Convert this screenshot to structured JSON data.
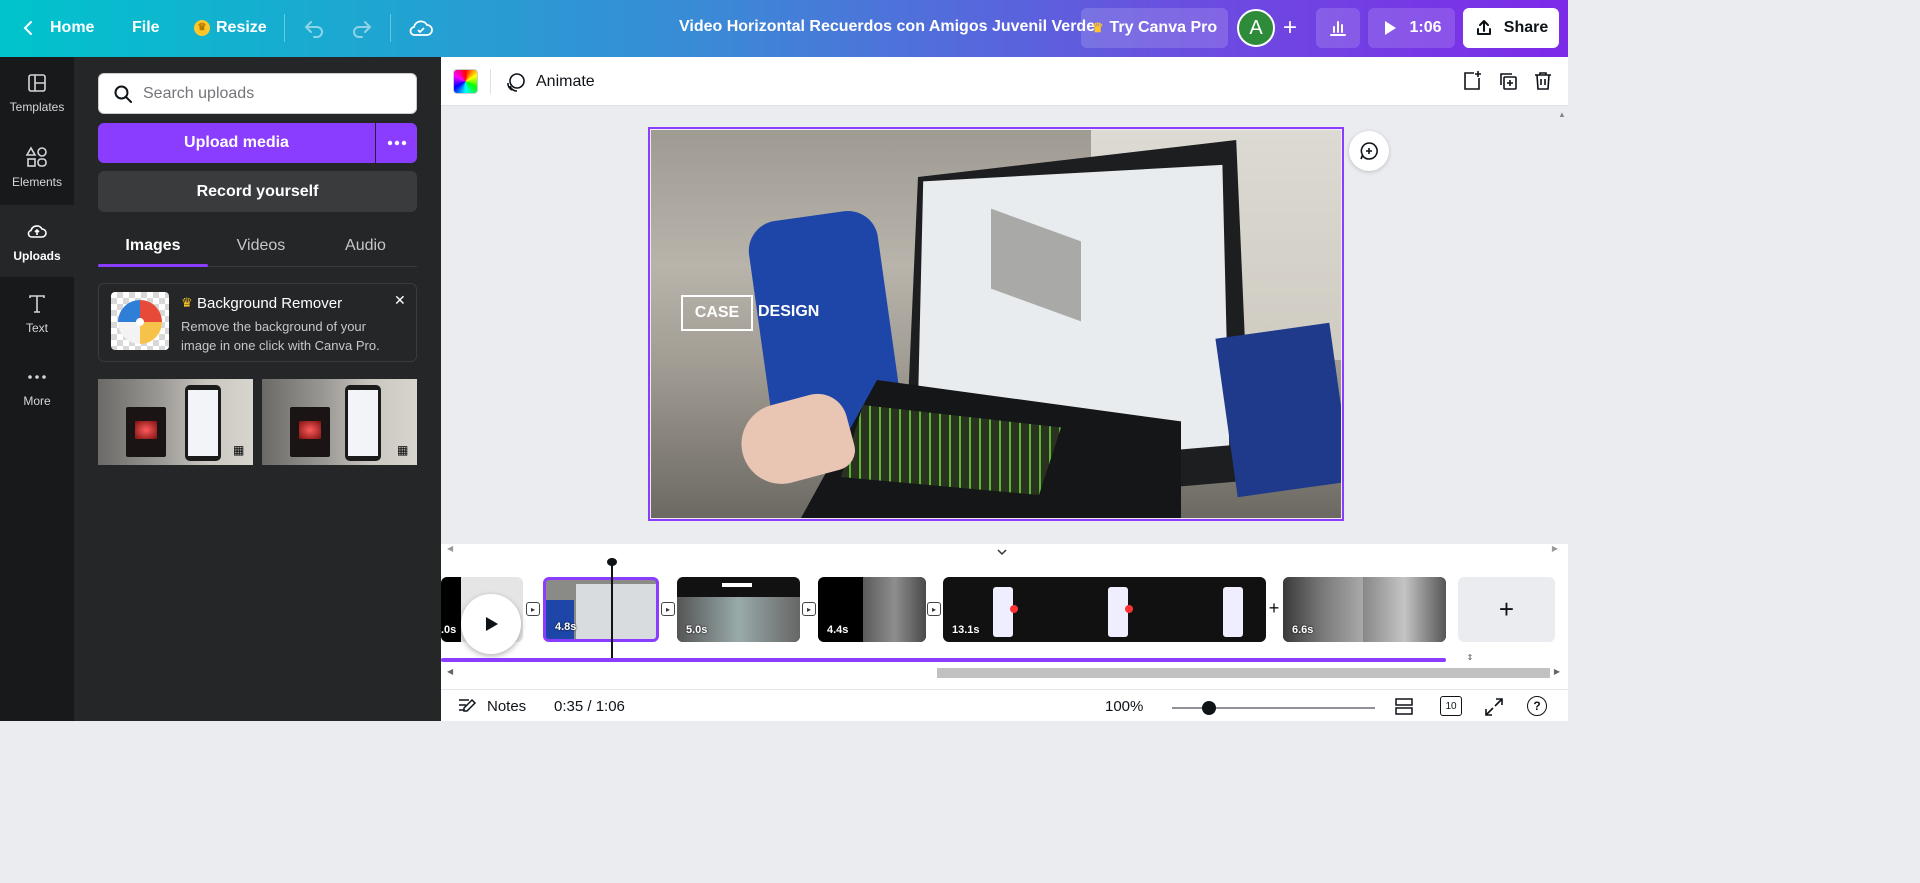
{
  "topbar": {
    "home_label": "Home",
    "file_label": "File",
    "resize_label": "Resize",
    "title": "Video Horizontal Recuerdos con Amigos Juvenil Verde",
    "try_pro_label": "Try Canva Pro",
    "avatar_letter": "A",
    "play_time": "1:06",
    "share_label": "Share"
  },
  "rail": {
    "items": [
      {
        "label": "Templates",
        "icon": "templates-icon"
      },
      {
        "label": "Elements",
        "icon": "elements-icon"
      },
      {
        "label": "Uploads",
        "icon": "uploads-icon",
        "active": true
      },
      {
        "label": "Text",
        "icon": "text-icon"
      },
      {
        "label": "More",
        "icon": "more-icon"
      }
    ]
  },
  "panel": {
    "search_placeholder": "Search uploads",
    "upload_label": "Upload media",
    "record_label": "Record yourself",
    "tabs": [
      "Images",
      "Videos",
      "Audio"
    ],
    "active_tab": "Images",
    "bg_remover": {
      "title": "Background Remover",
      "description": "Remove the background of your image in one click with Canva Pro."
    }
  },
  "context_bar": {
    "animate_label": "Animate"
  },
  "canvas": {
    "overlay_word_1": "CASE",
    "overlay_word_2": "DESIGN"
  },
  "timeline": {
    "clips": [
      {
        "duration": ".0s"
      },
      {
        "duration": "4.8s",
        "selected": true
      },
      {
        "duration": "5.0s"
      },
      {
        "duration": "4.4s"
      },
      {
        "duration": "13.1s"
      },
      {
        "duration": "6.6s"
      }
    ]
  },
  "bottombar": {
    "notes_label": "Notes",
    "time_display": "0:35 / 1:06",
    "zoom": "100%",
    "page_count": "10"
  },
  "colors": {
    "accent": "#8b3dff",
    "panel_bg": "#252627",
    "rail_bg": "#18191b"
  }
}
